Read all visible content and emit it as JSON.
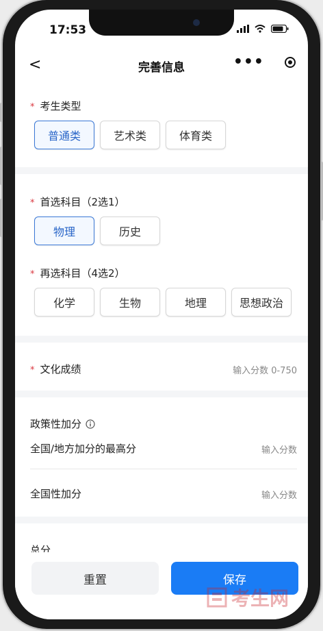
{
  "status_bar": {
    "time": "17:53"
  },
  "nav": {
    "back_glyph": "<",
    "title": "完善信息",
    "more_glyph": "•••"
  },
  "exam_type": {
    "required_mark": "*",
    "label": "考生类型",
    "options": [
      "普通类",
      "艺术类",
      "体育类"
    ],
    "selected": "普通类"
  },
  "first_subject": {
    "required_mark": "*",
    "label": "首选科目（2选1）",
    "options": [
      "物理",
      "历史"
    ],
    "selected": "物理"
  },
  "second_subject": {
    "required_mark": "*",
    "label": "再选科目（4选2）",
    "options": [
      "化学",
      "生物",
      "地理",
      "思想政治"
    ]
  },
  "culture_score": {
    "required_mark": "*",
    "label": "文化成绩",
    "placeholder": "输入分数 0-750"
  },
  "policy_bonus": {
    "title": "政策性加分",
    "info_icon": "info-icon",
    "rows": [
      {
        "label": "全国/地方加分的最高分",
        "placeholder": "输入分数"
      },
      {
        "label": "全国性加分",
        "placeholder": "输入分数"
      }
    ]
  },
  "total": {
    "label": "总分"
  },
  "actions": {
    "reset_label": "重置",
    "save_label": "保存"
  },
  "watermark": {
    "text": "考生网"
  },
  "colors": {
    "accent": "#1a7cf5",
    "selected_border": "#3a78d6",
    "required": "#d9363e"
  }
}
